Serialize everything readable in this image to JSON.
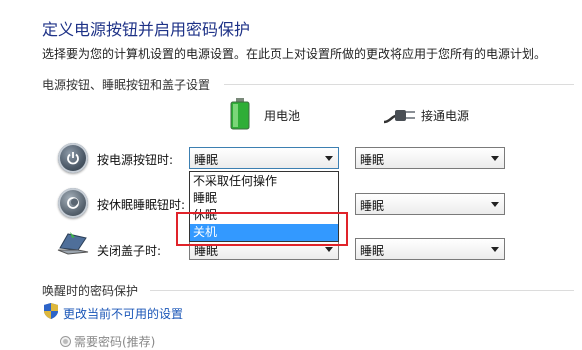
{
  "header": {
    "title": "定义电源按钮并启用密码保护",
    "subtitle": "选择要为您的计算机设置的电源设置。在此页上对设置所做的更改将应用于您所有的电源计划。"
  },
  "power_section": {
    "heading": "电源按钮、睡眠按钮和盖子设置",
    "battery_label": "用电池",
    "plugged_label": "接通电源",
    "rows": [
      {
        "label": "按电源按钮时:",
        "battery_value": "睡眠",
        "plugged_value": "睡眠",
        "icon": "power-button-icon"
      },
      {
        "label": "按休眠睡眠钮时:",
        "battery_value": "睡眠",
        "plugged_value": "睡眠",
        "icon": "sleep-button-icon"
      },
      {
        "label": "关闭盖子时:",
        "battery_value": "睡眠",
        "plugged_value": "睡眠",
        "icon": "laptop-lid-icon"
      }
    ]
  },
  "dropdown": {
    "options": [
      "不采取任何操作",
      "睡眠",
      "休眠",
      "关机"
    ],
    "highlighted": "关机"
  },
  "password_section": {
    "heading": "唤醒时的密码保护",
    "change_link": "更改当前不可用的设置",
    "require_password": "需要密码(推荐)"
  },
  "colors": {
    "title": "#1e3287",
    "link": "#1a56b7",
    "selection": "#3399ff",
    "annotation": "#e0232a"
  }
}
